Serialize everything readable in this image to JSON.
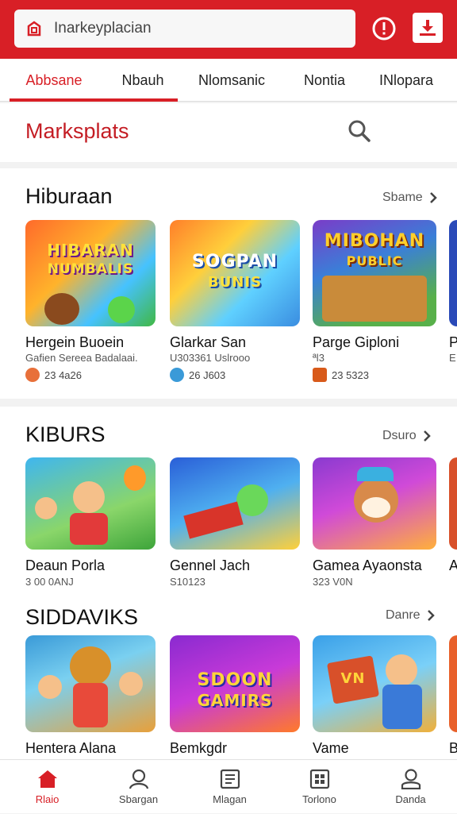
{
  "header": {
    "search_placeholder": "Inarkeyplacian",
    "brand_color": "#d81f26"
  },
  "tabs": [
    {
      "label": "Abbsane",
      "active": true
    },
    {
      "label": "Nbauh",
      "active": false
    },
    {
      "label": "Nlomsanic",
      "active": false
    },
    {
      "label": "Nontia",
      "active": false
    },
    {
      "label": "INlopara",
      "active": false
    }
  ],
  "page": {
    "title": "Marksplats"
  },
  "sections": [
    {
      "title": "Hiburaan",
      "more": "Sbame",
      "cards": [
        {
          "name": "Hergein Buoein",
          "sub": "Gafien Sereea Badalaai.",
          "meta": "23 4a26",
          "thumb_title": "HIBARAN",
          "thumb_title2": "NUMBALIS"
        },
        {
          "name": "Glarkar San",
          "sub": "U303361 Uslrooo",
          "meta": "26 J603",
          "thumb_title": "SOGPAN",
          "thumb_title2": "BUNIS"
        },
        {
          "name": "Parge Giploni",
          "sub": "ªl3",
          "meta": "23 5323",
          "thumb_title": "MIBOHAN",
          "thumb_title2": "PUBLIC"
        },
        {
          "name": "P",
          "sub": "E",
          "meta": ""
        }
      ]
    },
    {
      "title": "KIBURS",
      "more": "Dsuro",
      "cards": [
        {
          "name": "Deaun Porla",
          "sub": "3 00 0ANJ"
        },
        {
          "name": "Gennel Jach",
          "sub": "S10123"
        },
        {
          "name": "Gamea Ayaonsta",
          "sub": "323 V0N"
        },
        {
          "name": "A",
          "sub": ""
        }
      ]
    },
    {
      "title": "SIDDAVIKS",
      "more": "Danre",
      "cards": [
        {
          "name": "Hentera Alana",
          "thumb_title": ""
        },
        {
          "name": "Bemkgdr",
          "thumb_title": "SDOON",
          "thumb_title2": "GAMIRS"
        },
        {
          "name": "Vame",
          "thumb_title": "VN"
        },
        {
          "name": "B"
        }
      ]
    }
  ],
  "bottom_nav": [
    {
      "label": "Rlaio",
      "icon": "home-icon",
      "active": true
    },
    {
      "label": "Sbargan",
      "icon": "person-outline-icon",
      "active": false
    },
    {
      "label": "Mlagan",
      "icon": "document-icon",
      "active": false
    },
    {
      "label": "Torlono",
      "icon": "grid-icon",
      "active": false
    },
    {
      "label": "Danda",
      "icon": "profile-icon",
      "active": false
    }
  ]
}
